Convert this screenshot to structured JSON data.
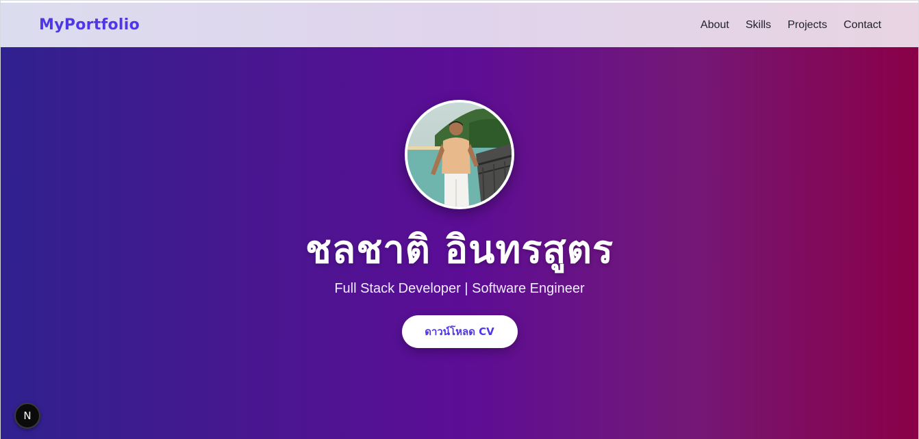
{
  "navbar": {
    "brand": "MyPortfolio",
    "links": [
      {
        "label": "About"
      },
      {
        "label": "Skills"
      },
      {
        "label": "Projects"
      },
      {
        "label": "Contact"
      }
    ]
  },
  "hero": {
    "avatar_icon": "profile-photo",
    "name": "ชลชาติ อินทรสูตร",
    "subtitle": "Full Stack Developer | Software Engineer",
    "cv_button_label": "ดาวน์โหลด CV"
  },
  "dev_badge": {
    "letter": "N"
  },
  "colors": {
    "brand": "#4f36e6",
    "hero_gradient_start": "#30218f",
    "hero_gradient_mid": "#5c0d96",
    "hero_gradient_end": "#8a0047"
  }
}
